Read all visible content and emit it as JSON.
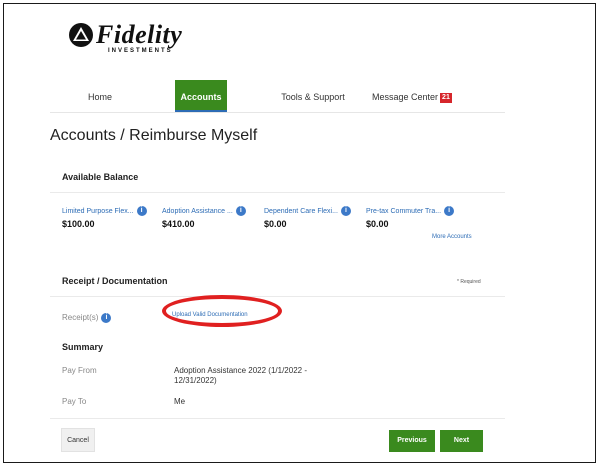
{
  "brand": {
    "name": "Fidelity",
    "subtitle": "INVESTMENTS",
    "green": "#3a8a1e",
    "link_blue": "#2d6cb5",
    "alert_red": "#d6262b"
  },
  "nav": {
    "home": "Home",
    "accounts": "Accounts",
    "tools": "Tools & Support",
    "message_center": "Message Center",
    "message_count": "21"
  },
  "page": {
    "title": "Accounts / Reimburse Myself"
  },
  "balance": {
    "heading": "Available Balance",
    "accounts": [
      {
        "name": "Limited Purpose Flex...",
        "amount": "$100.00"
      },
      {
        "name": "Adoption Assistance ...",
        "amount": "$410.00"
      },
      {
        "name": "Dependent Care Flexi...",
        "amount": "$0.00"
      },
      {
        "name": "Pre-tax Commuter Tra...",
        "amount": "$0.00"
      }
    ],
    "more_link": "More Accounts"
  },
  "receipt": {
    "heading": "Receipt / Documentation",
    "required_note": "* Required",
    "label": "Receipt(s)",
    "upload_link": "Upload Valid Documentation"
  },
  "summary": {
    "heading": "Summary",
    "pay_from_label": "Pay From",
    "pay_from_line1": "Adoption Assistance 2022 (1/1/2022 -",
    "pay_from_line2": "12/31/2022)",
    "pay_to_label": "Pay To",
    "pay_to_value": "Me"
  },
  "actions": {
    "cancel": "Cancel",
    "previous": "Previous",
    "next": "Next"
  },
  "icons": {
    "info": "i"
  }
}
